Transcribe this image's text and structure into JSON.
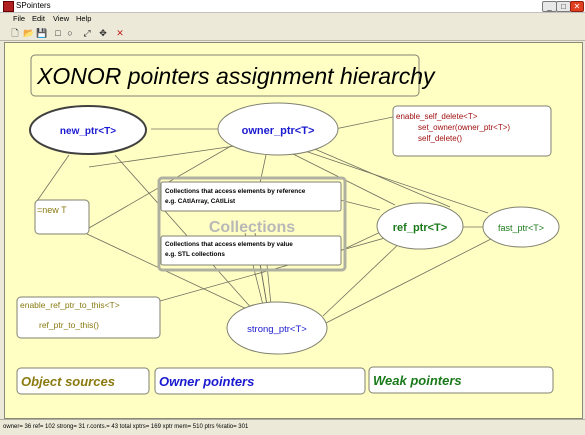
{
  "window": {
    "title": "SPointers",
    "controls": {
      "minimize": "_",
      "maximize": "□",
      "close": "✕"
    }
  },
  "menu": [
    "File",
    "Edit",
    "View",
    "Help"
  ],
  "toolbar": {
    "tools": [
      "new-file-icon",
      "open-folder-icon",
      "save-icon",
      "rectangle-icon",
      "ellipse-icon",
      "connector-icon",
      "move-icon",
      "delete-icon"
    ],
    "glyphs": [
      "🗋",
      "📂",
      "💾",
      "□",
      "○",
      "⤢",
      "✥",
      "✕"
    ]
  },
  "diagram": {
    "title": "XONOR pointers assignment hierarchy",
    "new_ptr": "new_ptr<T>",
    "owner_ptr": "owner_ptr<T>",
    "self_delete": {
      "line1": "enable_self_delete<T>",
      "line2": "set_owner(owner_ptr<T>)",
      "line3": "self_delete()"
    },
    "new_t": "=new T",
    "collections_ref": {
      "line1": "Collections that access elements by reference",
      "line2": "e.g. CAtlArray,  CAtlList"
    },
    "collections_label": "Collections",
    "collections_val": {
      "line1": "Collections that access elements by value",
      "line2": "e.g. STL collections"
    },
    "ref_ptr": "ref_ptr<T>",
    "fast_ptr": "fast_ptr<T>",
    "enable_ref": {
      "line1": "enable_ref_ptr_to_this<T>",
      "line2": "ref_ptr_to_this()"
    },
    "strong_ptr": "strong_ptr<T>",
    "legend": {
      "object_sources": "Object sources",
      "owner_pointers": "Owner pointers",
      "weak_pointers": "Weak pointers"
    },
    "colors": {
      "background": "#ffffc4",
      "owner_blue": "#1a1ad0",
      "weak_green": "#1a7a1a",
      "source_olive": "#8a7a10",
      "self_delete_red": "#a01010"
    }
  },
  "status": {
    "text": "owner= 36  ref= 102  strong=  31 r.conts.= 43   total xptrs= 169   xptr mem= 510 ptrs   %ratio= 301"
  }
}
